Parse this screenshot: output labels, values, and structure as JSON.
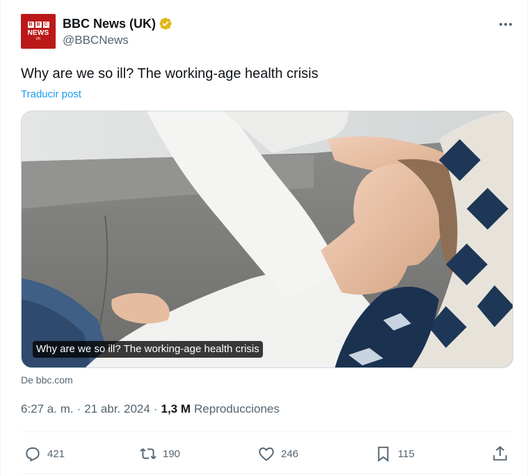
{
  "account": {
    "avatar_text": "BBC",
    "avatar_news": "NEWS",
    "avatar_region": "UK",
    "display_name": "BBC News (UK)",
    "handle": "@BBCNews",
    "verified_badge": "gold-verified-icon",
    "more_icon": "more-horizontal-icon"
  },
  "tweet": {
    "text": "Why are we so ill? The working-age health crisis",
    "translate_label": "Traducir post"
  },
  "media": {
    "caption": "Why are we so ill? The working-age health crisis",
    "source": "De bbc.com"
  },
  "meta": {
    "time": "6:27 a. m.",
    "separator": "·",
    "date": "21 abr. 2024",
    "views_count": "1,3 M",
    "views_label": "Reproducciones"
  },
  "actions": {
    "replies": "421",
    "reposts": "190",
    "likes": "246",
    "bookmarks": "115"
  },
  "colors": {
    "accent": "#1d9bf0",
    "brand": "#bb1919",
    "muted": "#536471",
    "verified": "#e2b719"
  }
}
